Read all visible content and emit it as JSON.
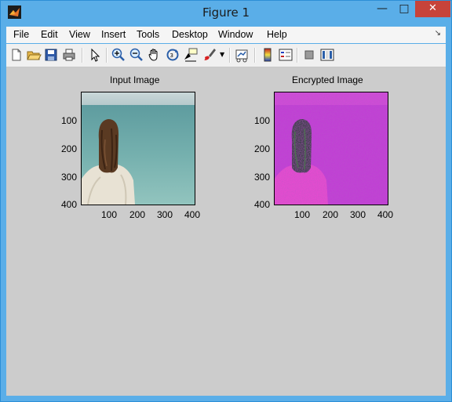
{
  "window": {
    "title": "Figure 1",
    "min": "—",
    "max": "□",
    "close": "✕"
  },
  "menu": [
    "File",
    "Edit",
    "View",
    "Insert",
    "Tools",
    "Desktop",
    "Window",
    "Help"
  ],
  "toolbar": {
    "icons": [
      "new-figure-icon",
      "open-file-icon",
      "save-icon",
      "print-icon",
      "arrow-icon",
      "zoom-in-icon",
      "zoom-out-icon",
      "pan-hand-icon",
      "rotate-3d-icon",
      "data-cursor-icon",
      "brush-icon",
      "link-plot-icon",
      "colorbar-icon",
      "legend-icon",
      "hide-plot-tools-icon",
      "show-plot-tools-icon"
    ]
  },
  "axes": [
    {
      "title": "Input Image",
      "yticks": [
        "100",
        "200",
        "300",
        "400"
      ],
      "xticks": [
        "100",
        "200",
        "300",
        "400"
      ]
    },
    {
      "title": "Encrypted Image",
      "yticks": [
        "100",
        "200",
        "300",
        "400"
      ],
      "xticks": [
        "100",
        "200",
        "300",
        "400"
      ]
    }
  ],
  "colors": {
    "figure_bg": "#cccccc",
    "titlebar": "#5aaee8",
    "close": "#c7433a"
  }
}
